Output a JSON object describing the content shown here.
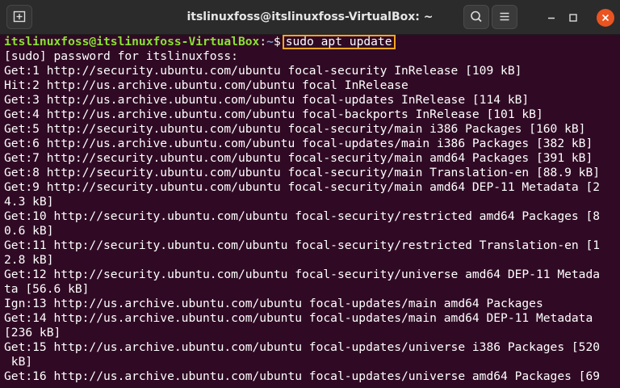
{
  "window": {
    "title": "itslinuxfoss@itslinuxfoss-VirtualBox: ~"
  },
  "toolbar": {
    "new_tab_icon": "new-tab-icon",
    "search_icon": "search-icon",
    "menu_icon": "hamburger-menu-icon",
    "minimize_icon": "minimize-icon",
    "maximize_icon": "maximize-icon",
    "close_icon": "close-icon",
    "close_color": "#e95420"
  },
  "terminal": {
    "prompt": {
      "user_host": "itslinuxfoss@itslinuxfoss-VirtualBox",
      "colon": ":",
      "path": "~",
      "symbol": "$",
      "command": "sudo apt update"
    },
    "lines": [
      "[sudo] password for itslinuxfoss:",
      "Get:1 http://security.ubuntu.com/ubuntu focal-security InRelease [109 kB]",
      "Hit:2 http://us.archive.ubuntu.com/ubuntu focal InRelease",
      "Get:3 http://us.archive.ubuntu.com/ubuntu focal-updates InRelease [114 kB]",
      "Get:4 http://us.archive.ubuntu.com/ubuntu focal-backports InRelease [101 kB]",
      "Get:5 http://security.ubuntu.com/ubuntu focal-security/main i386 Packages [160 kB]",
      "Get:6 http://us.archive.ubuntu.com/ubuntu focal-updates/main i386 Packages [382 kB]",
      "Get:7 http://security.ubuntu.com/ubuntu focal-security/main amd64 Packages [391 kB]",
      "Get:8 http://security.ubuntu.com/ubuntu focal-security/main Translation-en [88.9 kB]",
      "Get:9 http://security.ubuntu.com/ubuntu focal-security/main amd64 DEP-11 Metadata [2",
      "4.3 kB]",
      "Get:10 http://security.ubuntu.com/ubuntu focal-security/restricted amd64 Packages [8",
      "0.6 kB]",
      "Get:11 http://security.ubuntu.com/ubuntu focal-security/restricted Translation-en [1",
      "2.8 kB]",
      "Get:12 http://security.ubuntu.com/ubuntu focal-security/universe amd64 DEP-11 Metada",
      "ta [56.6 kB]",
      "Ign:13 http://us.archive.ubuntu.com/ubuntu focal-updates/main amd64 Packages",
      "Get:14 http://us.archive.ubuntu.com/ubuntu focal-updates/main amd64 DEP-11 Metadata",
      "[236 kB]",
      "Get:15 http://us.archive.ubuntu.com/ubuntu focal-updates/universe i386 Packages [520",
      " kB]",
      "Get:16 http://us.archive.ubuntu.com/ubuntu focal-updates/universe amd64 Packages [69"
    ]
  },
  "colors": {
    "terminal_bg": "#300a24",
    "titlebar_bg": "#2b2b2b",
    "prompt_user": "#8ae234",
    "prompt_path": "#729fcf",
    "highlight_box": "#f5a623"
  }
}
